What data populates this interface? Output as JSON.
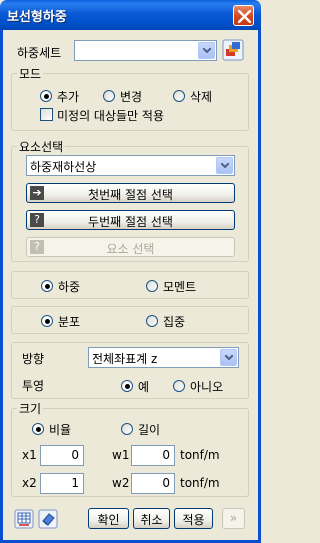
{
  "window": {
    "title": "보선형하중"
  },
  "load_set": {
    "label": "하중세트",
    "value": ""
  },
  "mode": {
    "title": "모드",
    "options": [
      "추가",
      "변경",
      "삭제"
    ],
    "selected": "추가",
    "only_unassigned_label": "미정의 대상들만 적용"
  },
  "element_select": {
    "title": "요소선택",
    "dropdown_value": "하중재하선상",
    "first_node_button": "첫번째 절점 선택",
    "second_node_button": "두번째 절점 선택",
    "element_button": "요소 선택"
  },
  "load_type": {
    "options": [
      "하중",
      "모멘트"
    ],
    "selected": "하중"
  },
  "distribution": {
    "options": [
      "분포",
      "집중"
    ],
    "selected": "분포"
  },
  "direction": {
    "label": "방향",
    "value": "전체좌표계 z"
  },
  "projection": {
    "label": "투영",
    "options": [
      "예",
      "아니오"
    ],
    "selected": "예"
  },
  "magnitude": {
    "title": "크기",
    "options": [
      "비율",
      "길이"
    ],
    "selected": "비율",
    "fields": [
      {
        "name": "x1",
        "value": "0"
      },
      {
        "name": "w1",
        "value": "0",
        "unit": "tonf/m"
      },
      {
        "name": "x2",
        "value": "1"
      },
      {
        "name": "w2",
        "value": "0",
        "unit": "tonf/m"
      }
    ]
  },
  "footer": {
    "ok": "확인",
    "cancel": "취소",
    "apply": "적용",
    "expand": "»"
  },
  "icons": [
    "close-icon",
    "load-set-icon",
    "dropdown-arrow-icon",
    "select-arrow-icon",
    "help-icon",
    "table-icon",
    "eraser-icon"
  ]
}
